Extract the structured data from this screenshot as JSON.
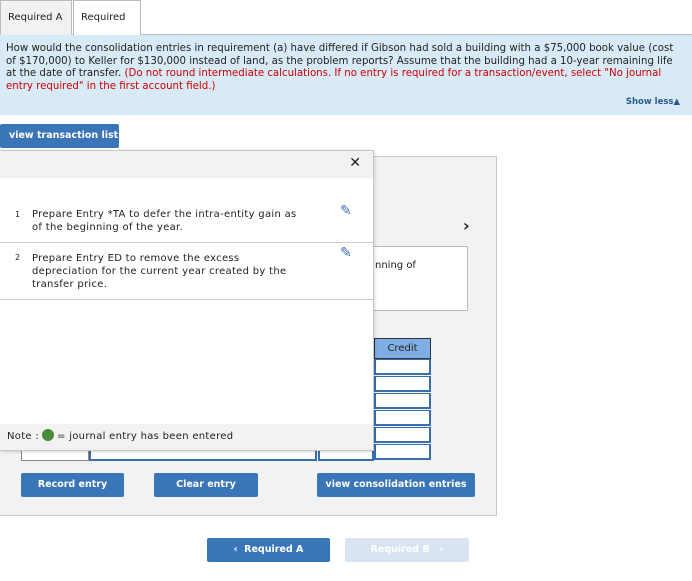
{
  "tabs": [
    {
      "label": "Required A"
    },
    {
      "label": "Required B"
    }
  ],
  "question": {
    "text": "How would the consolidation entries in requirement (a) have differed if Gibson had sold a building with a $75,000 book value (cost of $170,000) to Keller for $130,000 instead of land, as the problem reports? Assume that the building had a 10-year remaining life at the date of transfer.",
    "instruction": "(Do not round intermediate calculations. If no entry is required for a transaction/event, select \"No journal entry required\" in the first account field.)",
    "show_less": "Show less▲"
  },
  "view_transaction_list": "view transaction list",
  "background": {
    "partial_text": "nning of",
    "credit_header": "Credit"
  },
  "transactions": [
    {
      "num": "1",
      "text": "Prepare Entry *TA to defer the intra-entity gain as of the beginning of the year."
    },
    {
      "num": "2",
      "text": "Prepare Entry ED to remove the excess depreciation for the current year created by the transfer price."
    }
  ],
  "note": {
    "label": "Note :",
    "text": "= journal entry has been entered"
  },
  "buttons": {
    "record": "Record entry",
    "clear": "Clear entry",
    "view_consolidation": "view consolidation entries",
    "prev": "Required A",
    "next": "Required B"
  },
  "colors": {
    "accent": "#3a75b8",
    "note_dot": "#4a8a3a",
    "instruction": "#cc0000"
  }
}
